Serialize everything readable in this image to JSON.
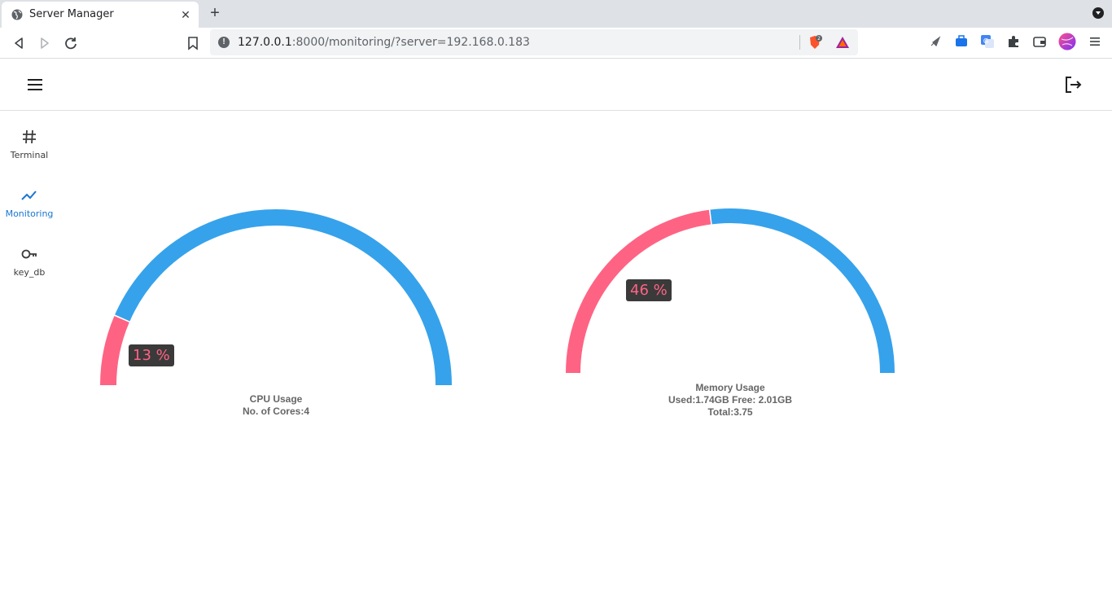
{
  "browser": {
    "tab_title": "Server Manager",
    "url_host": "127.0.0.1",
    "url_rest": ":8000/monitoring/?server=192.168.0.183",
    "brave_badge": "2"
  },
  "sidebar": {
    "items": [
      {
        "label": "Terminal",
        "icon": "hash-icon",
        "active": false
      },
      {
        "label": "Monitoring",
        "icon": "trending-up-icon",
        "active": true
      },
      {
        "label": "key_db",
        "icon": "key-icon",
        "active": false
      }
    ]
  },
  "colors": {
    "used": "#ff6384",
    "free": "#36a2eb",
    "active_nav": "#1976d2"
  },
  "cpu": {
    "percent_label": "13 %",
    "used_fraction": 0.13,
    "title": "CPU Usage",
    "detail": "No. of Cores:4"
  },
  "memory": {
    "percent_label": "46 %",
    "used_fraction": 0.46,
    "title": "Memory Usage",
    "detail": "Used:1.74GB Free: 2.01GB",
    "total": "Total:3.75"
  }
}
